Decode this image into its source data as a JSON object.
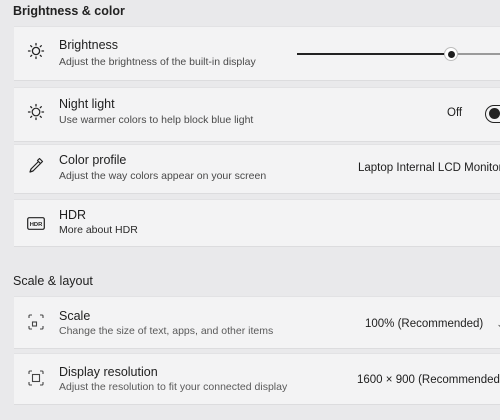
{
  "sections": {
    "brightness_color": "Brightness & color",
    "scale_layout": "Scale & layout"
  },
  "brightness": {
    "title": "Brightness",
    "description": "Adjust the brightness of the built-in display",
    "level_fraction": 0.76,
    "icon": "sun-icon"
  },
  "night_light": {
    "title": "Night light",
    "description": "Use warmer colors to help block blue light",
    "state_label": "Off",
    "enabled": false,
    "icon": "night-light-icon"
  },
  "color_profile": {
    "title": "Color profile",
    "description": "Adjust the way colors appear on your screen",
    "selected": "Laptop Internal LCD Monitor",
    "icon": "eyedropper-icon"
  },
  "hdr": {
    "title": "HDR",
    "link": "More about HDR",
    "icon": "hdr-icon",
    "icon_text": "HDR"
  },
  "scale": {
    "title": "Scale",
    "description": "Change the size of text, apps, and other items",
    "selected": "100% (Recommended)",
    "icon": "scale-icon"
  },
  "resolution": {
    "title": "Display resolution",
    "description": "Adjust the resolution to fit your connected display",
    "selected": "1600 × 900 (Recommended)",
    "icon": "resolution-icon"
  },
  "colors": {
    "card": "#f3f3f4",
    "page": "#e9e9eb",
    "accent": "#1e1e1e"
  }
}
